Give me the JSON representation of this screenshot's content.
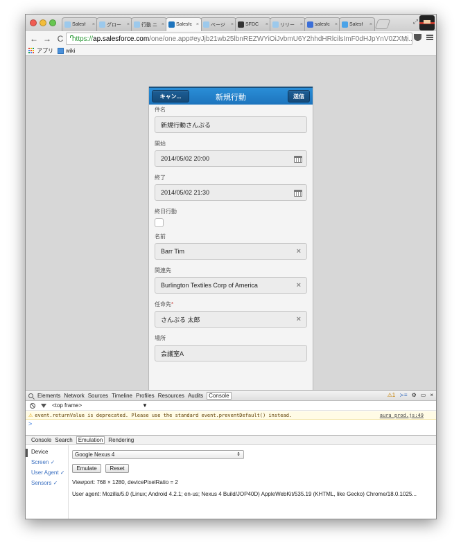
{
  "browser": {
    "tabs": [
      {
        "label": "Salesf",
        "icon": "cloud-icon",
        "active": false
      },
      {
        "label": "グロー",
        "icon": "cloud-icon",
        "active": false
      },
      {
        "label": "行動 ニ",
        "icon": "cloud-icon",
        "active": false
      },
      {
        "label": "Salesfc",
        "icon": "salesforce-icon",
        "active": true
      },
      {
        "label": "ページ",
        "icon": "cloud-icon",
        "active": false
      },
      {
        "label": "SFDC",
        "icon": "ninja-icon",
        "active": false
      },
      {
        "label": "リリー",
        "icon": "cloud-icon",
        "active": false
      },
      {
        "label": "salesfc",
        "icon": "google-icon",
        "active": false
      },
      {
        "label": "Salesf",
        "icon": "sf-app-icon",
        "active": false
      }
    ],
    "tab_close": "×",
    "url_scheme": "https://",
    "url_host": "ap.salesforce.com",
    "url_path": "/one/one.app#eyJjb21wb25lbnREZWYiOiJvbmU6Y2hhdHRlcilsImF0dHJpYnV0ZXMi...",
    "bookmarks": [
      {
        "label": "アプリ",
        "icon": "apps-grid-icon"
      },
      {
        "label": "wiki",
        "icon": "wiki-icon"
      }
    ],
    "colors": {
      "secure": "#2e9b3a",
      "window_bg": "#d7d7d7"
    }
  },
  "mobile": {
    "header": {
      "cancel_label": "キャン...",
      "title": "新規行動",
      "send_label": "送信",
      "color": "#1d74bd"
    },
    "fields": {
      "subject_label": "件名",
      "subject_value": "新規行動さんぷる",
      "start_label": "開始",
      "start_value": "2014/05/02 20:00",
      "end_label": "終了",
      "end_value": "2014/05/02 21:30",
      "allday_label": "終日行動",
      "name_label": "名前",
      "name_value": "Barr Tim",
      "related_label": "関連先",
      "related_value": "Burlington Textiles Corp of America",
      "assigned_label": "任命先",
      "assigned_required": "*",
      "assigned_value": "さんぷる 太郎",
      "location_label": "場所",
      "location_value": "会議室A"
    },
    "clear_symbol": "×"
  },
  "devtools": {
    "tabs": [
      "Elements",
      "Network",
      "Sources",
      "Timeline",
      "Profiles",
      "Resources",
      "Audits",
      "Console"
    ],
    "active_tab": "Console",
    "warning_count": "1",
    "frame_selector": "<top frame>",
    "console_message": "event.returnValue is deprecated. Please use the standard event.preventDefault() instead.",
    "console_source": "aura_prod.js:49",
    "prompt": ">",
    "drawer_tabs": [
      "Console",
      "Search",
      "Emulation",
      "Rendering"
    ],
    "drawer_active": "Emulation",
    "emulation": {
      "sidebar": [
        "Device",
        "Screen ✓",
        "User Agent ✓",
        "Sensors ✓"
      ],
      "device": "Google Nexus 4",
      "select_arrow": "⇕",
      "emulate_label": "Emulate",
      "reset_label": "Reset",
      "viewport_key": "Viewport:",
      "viewport_value": "768 × 1280, devicePixelRatio = 2",
      "ua_key": "User agent:",
      "ua_value": "Mozilla/5.0 (Linux; Android 4.2.1; en-us; Nexus 4 Build/JOP40D) AppleWebKit/535.19 (KHTML, like Gecko) Chrome/18.0.1025..."
    }
  }
}
